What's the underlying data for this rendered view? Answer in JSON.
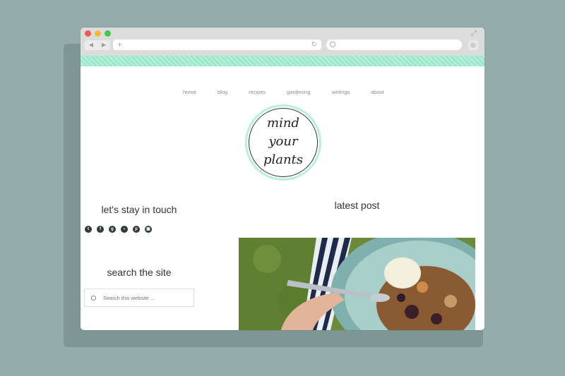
{
  "site": {
    "nav": [
      "home",
      "blog",
      "recipes",
      "gardening",
      "writings",
      "about"
    ],
    "logo_lines": [
      "mind",
      "your",
      "plants"
    ],
    "stay_in_touch": "let's stay in touch",
    "social_icons": [
      "twitter-icon",
      "facebook-icon",
      "google-plus-icon",
      "rss-icon",
      "pinterest-icon",
      "instagram-icon"
    ],
    "search_heading": "search the site",
    "search_placeholder": "Search this website ...",
    "latest_heading": "latest post"
  },
  "colors": {
    "background": "#95adaa",
    "accent_mint": "#97e6c9"
  }
}
